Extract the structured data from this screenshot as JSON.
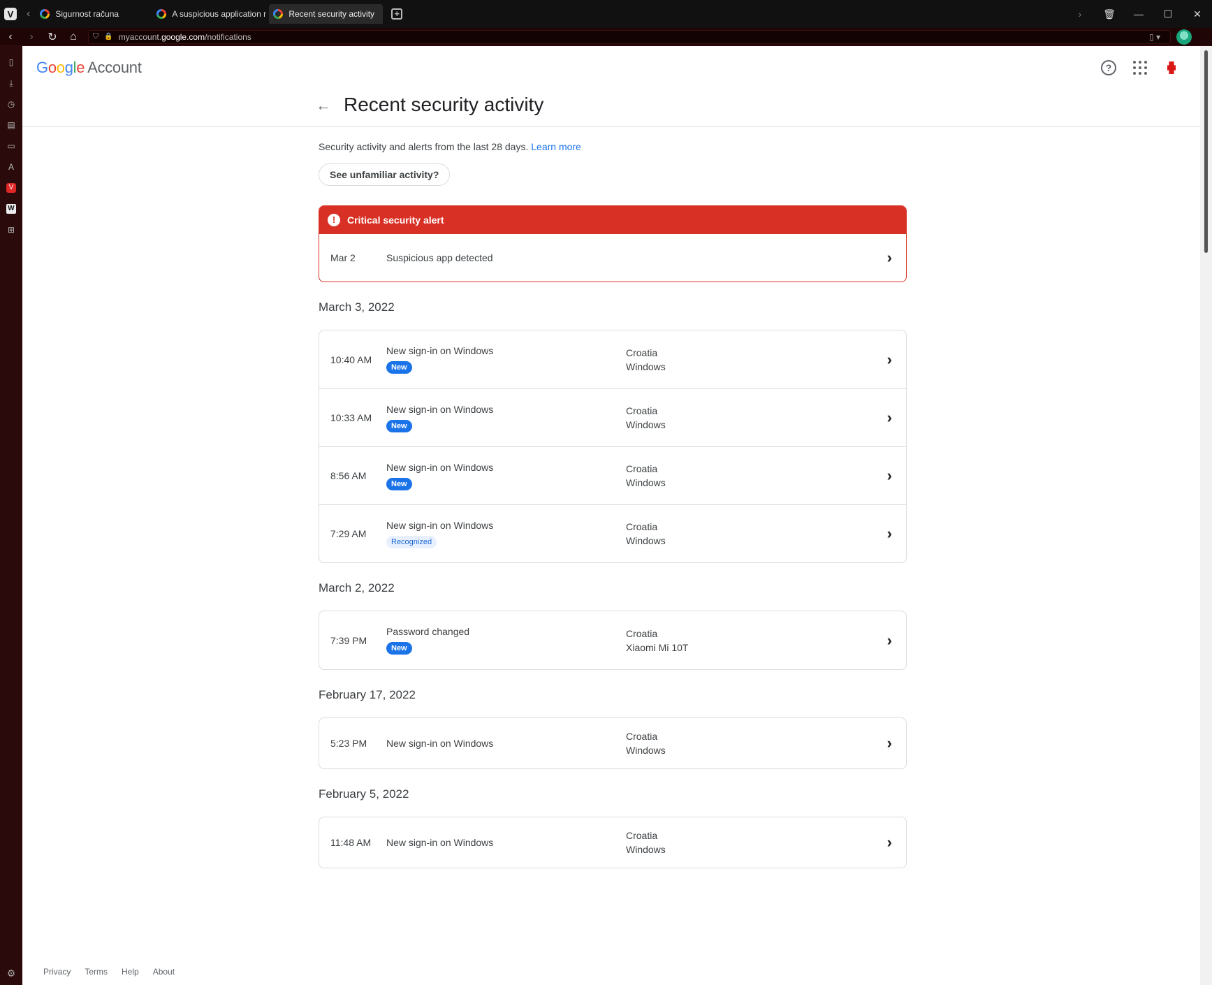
{
  "browser": {
    "tabs": [
      {
        "label": "Sigurnost računa"
      },
      {
        "label": "A suspicious application ma"
      },
      {
        "label": "Recent security activity"
      }
    ],
    "url_prefix": "myaccount.",
    "url_host": "google.com",
    "url_path": "/notifications"
  },
  "header": {
    "logo": {
      "g1": "G",
      "o1": "o",
      "o2": "o",
      "g2": "g",
      "l": "l",
      "e": "e"
    },
    "account_label": "Account"
  },
  "page": {
    "title": "Recent security activity",
    "intro": "Security activity and alerts from the last 28 days.",
    "learn_more": "Learn more",
    "unfamiliar_button": "See unfamiliar activity?"
  },
  "alert": {
    "title": "Critical security alert",
    "date": "Mar 2",
    "description": "Suspicious app detected"
  },
  "groups": [
    {
      "date": "March 3, 2022",
      "rows": [
        {
          "time": "10:40 AM",
          "event": "New sign-in on Windows",
          "badge": "New",
          "location": "Croatia",
          "device": "Windows"
        },
        {
          "time": "10:33 AM",
          "event": "New sign-in on Windows",
          "badge": "New",
          "location": "Croatia",
          "device": "Windows"
        },
        {
          "time": "8:56 AM",
          "event": "New sign-in on Windows",
          "badge": "New",
          "location": "Croatia",
          "device": "Windows"
        },
        {
          "time": "7:29 AM",
          "event": "New sign-in on Windows",
          "badge": "Recognized",
          "location": "Croatia",
          "device": "Windows"
        }
      ]
    },
    {
      "date": "March 2, 2022",
      "rows": [
        {
          "time": "7:39 PM",
          "event": "Password changed",
          "badge": "New",
          "location": "Croatia",
          "device": "Xiaomi Mi 10T"
        }
      ]
    },
    {
      "date": "February 17, 2022",
      "rows": [
        {
          "time": "5:23 PM",
          "event": "New sign-in on Windows",
          "location": "Croatia",
          "device": "Windows"
        }
      ]
    },
    {
      "date": "February 5, 2022",
      "rows": [
        {
          "time": "11:48 AM",
          "event": "New sign-in on Windows",
          "location": "Croatia",
          "device": "Windows"
        }
      ]
    }
  ],
  "footer": {
    "privacy": "Privacy",
    "terms": "Terms",
    "help": "Help",
    "about": "About"
  },
  "colors": {
    "alert_red": "#d93025",
    "link_blue": "#1a73e8",
    "badge_new": "#1a73e8",
    "badge_recognized_bg": "#e8f0fe"
  }
}
